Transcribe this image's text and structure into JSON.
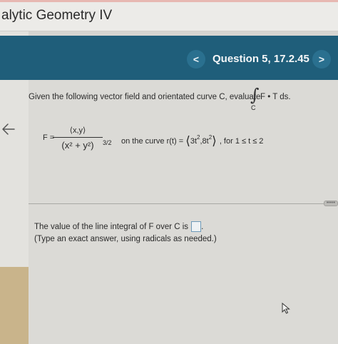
{
  "app": {
    "title": "alytic Geometry IV"
  },
  "header": {
    "question_title": "Question 5, 17.2.45",
    "prev_label": "<",
    "next_label": ">"
  },
  "question": {
    "prompt_lead": "Given the following vector field and orientated curve C, evaluate",
    "integral_symbol": "∫",
    "integral_subscript": "C",
    "integrand": "F • T ds.",
    "F_lhs": "F =",
    "F_numerator": "⟨x,y⟩",
    "F_denominator": "(x² + y²)",
    "F_den_exponent": "3/2",
    "curve_prefix": "on the curve r(t) =",
    "curve_open": "⟨",
    "curve_x": "3t",
    "curve_x_exp": "2",
    "curve_sep": ",",
    "curve_y": "8t",
    "curve_y_exp": "2",
    "curve_close": "⟩",
    "curve_range": ", for 1 ≤ t ≤ 2"
  },
  "answer": {
    "label": "The value of the line integral of F over C is",
    "end_punct": ".",
    "instruction": "(Type an exact answer, using radicals as needed.)",
    "value": ""
  },
  "more_dots": "•••••",
  "icons": {
    "back": "left-arrow-icon",
    "cursor": "mouse-cursor-icon"
  },
  "colors": {
    "header_bg": "#1f5e7a",
    "accent_tan": "#c9b48b",
    "answer_box_border": "#6e9ab8"
  }
}
